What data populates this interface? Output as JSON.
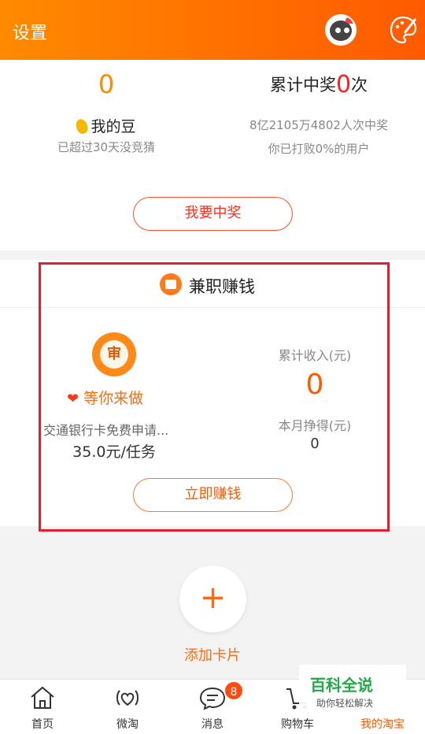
{
  "header": {
    "title": "设置"
  },
  "beans": {
    "count": "0",
    "title": "我的豆",
    "subtitle": "已超过30天没竞猜"
  },
  "prize": {
    "label_before": "累计中奖",
    "count": "0",
    "label_after": "次",
    "total": "8亿2105万4802人次中奖",
    "beat": "你已打败0%的用户"
  },
  "win_button": "我要中奖",
  "parttime": {
    "title": "兼职赚钱",
    "shield_char": "审",
    "waiting": "等你来做",
    "task_desc": "交通银行卡免费申请...",
    "task_price": "35.0元/任务",
    "income_label": "累计收入(元)",
    "income_value": "0",
    "month_label": "本月挣得(元)",
    "month_value": "0",
    "earn_button": "立即赚钱"
  },
  "add_card": {
    "icon": "+",
    "label": "添加卡片"
  },
  "tabs": [
    {
      "label": "首页",
      "icon": "home-icon"
    },
    {
      "label": "微淘",
      "icon": "weitao-icon"
    },
    {
      "label": "消息",
      "icon": "message-icon"
    },
    {
      "label": "购物车",
      "icon": "cart-icon"
    },
    {
      "label": "我的淘宝",
      "icon": "profile-icon"
    }
  ],
  "message_badge": "8",
  "watermark": {
    "line1": "百科全说",
    "line2": "助你轻松解决"
  },
  "colors": {
    "accent": "#ff5a00",
    "highlight_border": "#e02030",
    "prize_red": "#ff2020"
  }
}
